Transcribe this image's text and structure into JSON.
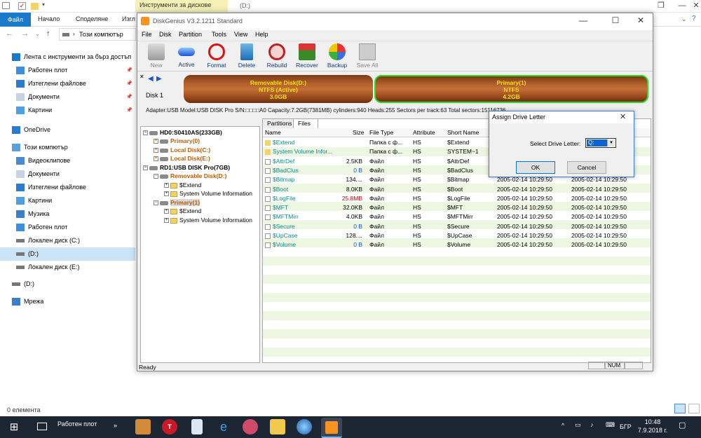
{
  "explorer": {
    "context_tab": "Инструменти за дискове",
    "drive_title": "(D:)",
    "ribbon_tabs": {
      "file": "Файл",
      "home": "Начало",
      "share": "Споделяне",
      "view": "Изгл"
    },
    "address": "Този компютър",
    "nav": [
      {
        "label": "Лента с инструменти за бърз достъп",
        "icon": "star-icon",
        "pinned": false
      },
      {
        "label": "Работен плот",
        "icon": "desktop-icon",
        "pinned": true
      },
      {
        "label": "Изтеглени файлове",
        "icon": "download-icon",
        "pinned": true
      },
      {
        "label": "Документи",
        "icon": "documents-icon",
        "pinned": true
      },
      {
        "label": "Картини",
        "icon": "pictures-icon",
        "pinned": true
      },
      {
        "label": "OneDrive",
        "icon": "cloud-icon",
        "pinned": false
      },
      {
        "label": "Този компютър",
        "icon": "computer-icon",
        "pinned": false
      },
      {
        "label": "Видеоклипове",
        "icon": "video-icon",
        "pinned": false
      },
      {
        "label": "Документи",
        "icon": "documents-icon",
        "pinned": false
      },
      {
        "label": "Изтеглени файлове",
        "icon": "download-icon",
        "pinned": false
      },
      {
        "label": "Картини",
        "icon": "pictures-icon",
        "pinned": false
      },
      {
        "label": "Музика",
        "icon": "music-icon",
        "pinned": false
      },
      {
        "label": "Работен плот",
        "icon": "desktop-icon",
        "pinned": false
      },
      {
        "label": "Локален диск (C:)",
        "icon": "drive-icon",
        "pinned": false
      },
      {
        "label": "(D:)",
        "icon": "drive-icon",
        "pinned": false,
        "selected": true
      },
      {
        "label": "Локален диск (E:)",
        "icon": "drive-icon",
        "pinned": false
      },
      {
        "label": "(D:)",
        "icon": "drive-icon",
        "pinned": false
      },
      {
        "label": "Мрежа",
        "icon": "network-icon",
        "pinned": false
      }
    ],
    "status": "0 елемента"
  },
  "taskbar": {
    "search": "Работен плот",
    "language": "БГР",
    "time": "10:48",
    "date": "7.9.2018 г."
  },
  "dg": {
    "title": "DiskGenius V3.2.1211 Standard",
    "menu": [
      "File",
      "Disk",
      "Partition",
      "Tools",
      "View",
      "Help"
    ],
    "toolbar": [
      {
        "label": "New",
        "icon": "new-disk-icon",
        "enabled": false
      },
      {
        "label": "Active",
        "icon": "active-icon",
        "enabled": true
      },
      {
        "label": "Format",
        "icon": "format-icon",
        "enabled": true
      },
      {
        "label": "Delete",
        "icon": "delete-icon",
        "enabled": true
      },
      {
        "label": "Rebuild",
        "icon": "rebuild-icon",
        "enabled": true
      },
      {
        "label": "Recover",
        "icon": "recover-icon",
        "enabled": true
      },
      {
        "label": "Backup",
        "icon": "backup-icon",
        "enabled": true
      },
      {
        "label": "Save All",
        "icon": "save-all-icon",
        "enabled": false
      }
    ],
    "disk_label": "Disk  1",
    "partitions": [
      {
        "name": "Removable Disk(D:)",
        "fs": "NTFS (Active)",
        "size": "3.0GB"
      },
      {
        "name": "Primary(1)",
        "fs": "NTFS",
        "size": "4.2GB"
      }
    ],
    "info": "Adapter:USB  Model:USB DISK Pro  S/N:□□□□A0  Capacity:7.2GB(7381MB)  cylinders:940  Heads:255  Sectors per track:63  Total sectors:15116736",
    "tree": [
      {
        "label": "HD0:S0410AS(233GB)",
        "style": "hd",
        "indent": 0,
        "kind": "disk"
      },
      {
        "label": "Primary(0)",
        "style": "or",
        "indent": 1,
        "kind": "part"
      },
      {
        "label": "Local Disk(C:)",
        "style": "or",
        "indent": 1,
        "kind": "part"
      },
      {
        "label": "Local Disk(E:)",
        "style": "or",
        "indent": 1,
        "kind": "part"
      },
      {
        "label": "RD1:USB DISK Pro(7GB)",
        "style": "hd",
        "indent": 0,
        "kind": "disk"
      },
      {
        "label": "Removable Disk(D:)",
        "style": "or",
        "indent": 1,
        "kind": "part"
      },
      {
        "label": "$Extend",
        "style": "",
        "indent": 2,
        "kind": "folder"
      },
      {
        "label": "System Volume Information",
        "style": "",
        "indent": 2,
        "kind": "folder"
      },
      {
        "label": "Primary(1)",
        "style": "or sel",
        "indent": 1,
        "kind": "part"
      },
      {
        "label": "$Extend",
        "style": "",
        "indent": 2,
        "kind": "folder"
      },
      {
        "label": "System Volume Information",
        "style": "",
        "indent": 2,
        "kind": "folder"
      }
    ],
    "tabs": [
      "Partitions",
      "Files"
    ],
    "columns": [
      "Name",
      "Size",
      "File Type",
      "Attribute",
      "Short Name"
    ],
    "files": [
      {
        "name": "$Extend",
        "size": "",
        "type": "Папка с ф...",
        "attr": "HS",
        "short": "$Extend",
        "sizecolor": "",
        "folder": true,
        "d1": "",
        "d2": ""
      },
      {
        "name": "System Volume Infor...",
        "size": "",
        "type": "Папка с ф...",
        "attr": "HS",
        "short": "SYSTEM~1",
        "sizecolor": "",
        "folder": true,
        "d1": "",
        "d2": ""
      },
      {
        "name": "$AttrDef",
        "size": "2.5KB",
        "type": "Файл",
        "attr": "HS",
        "short": "$AttrDef",
        "sizecolor": "",
        "folder": false,
        "d1": "",
        "d2": ""
      },
      {
        "name": "$BadClus",
        "size": "0 B",
        "type": "Файл",
        "attr": "HS",
        "short": "$BadClus",
        "sizecolor": "blue",
        "folder": false,
        "d1": "",
        "d2": ""
      },
      {
        "name": "$Bitmap",
        "size": "134....",
        "type": "Файл",
        "attr": "HS",
        "short": "$Bitmap",
        "sizecolor": "",
        "folder": false,
        "d1": "2005-02-14 10:29:50",
        "d2": "2005-02-14 10:29:50"
      },
      {
        "name": "$Boot",
        "size": "8.0KB",
        "type": "Файл",
        "attr": "HS",
        "short": "$Boot",
        "sizecolor": "",
        "folder": false,
        "d1": "2005-02-14 10:29:50",
        "d2": "2005-02-14 10:29:50"
      },
      {
        "name": "$LogFile",
        "size": "25.8MB",
        "type": "Файл",
        "attr": "HS",
        "short": "$LogFile",
        "sizecolor": "red",
        "folder": false,
        "d1": "2005-02-14 10:29:50",
        "d2": "2005-02-14 10:29:50"
      },
      {
        "name": "$MFT",
        "size": "32.0KB",
        "type": "Файл",
        "attr": "HS",
        "short": "$MFT",
        "sizecolor": "",
        "folder": false,
        "d1": "2005-02-14 10:29:50",
        "d2": "2005-02-14 10:29:50"
      },
      {
        "name": "$MFTMirr",
        "size": "4.0KB",
        "type": "Файл",
        "attr": "HS",
        "short": "$MFTMirr",
        "sizecolor": "",
        "folder": false,
        "d1": "2005-02-14 10:29:50",
        "d2": "2005-02-14 10:29:50"
      },
      {
        "name": "$Secure",
        "size": "0 B",
        "type": "Файл",
        "attr": "HS",
        "short": "$Secure",
        "sizecolor": "blue",
        "folder": false,
        "d1": "2005-02-14 10:29:50",
        "d2": "2005-02-14 10:29:50"
      },
      {
        "name": "$UpCase",
        "size": "128....",
        "type": "Файл",
        "attr": "HS",
        "short": "$UpCase",
        "sizecolor": "",
        "folder": false,
        "d1": "2005-02-14 10:29:50",
        "d2": "2005-02-14 10:29:50"
      },
      {
        "name": "$Volume",
        "size": "0 B",
        "type": "Файл",
        "attr": "HS",
        "short": "$Volume",
        "sizecolor": "blue",
        "folder": false,
        "d1": "2005-02-14 10:29:50",
        "d2": "2005-02-14 10:29:50"
      }
    ],
    "status": "Ready",
    "status_num": "NUM"
  },
  "dialog": {
    "title": "Assign Drive Letter",
    "label": "Select Drive Letter:",
    "value": "Q:",
    "ok": "OK",
    "cancel": "Cancel"
  },
  "colors": {
    "accent": "#1979ca",
    "partition_border": "#22e022",
    "partition_text": "#f6e200",
    "taskbar": "#1c2532"
  }
}
